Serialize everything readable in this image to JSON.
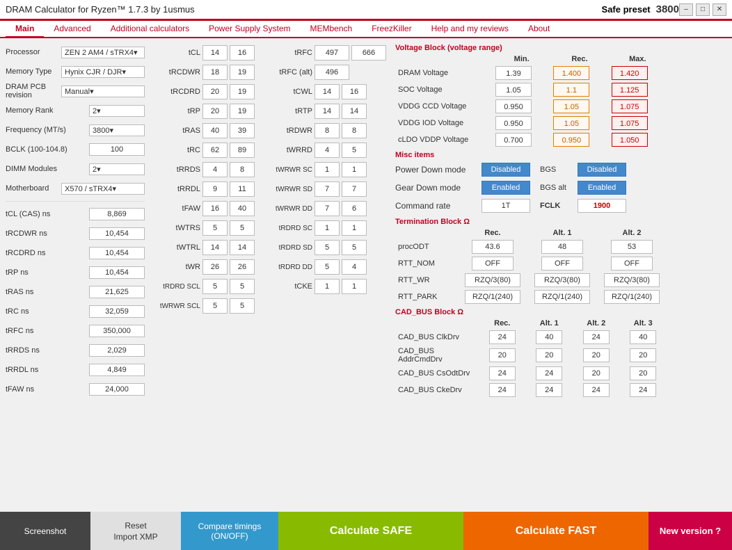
{
  "titlebar": {
    "title": "DRAM Calculator for Ryzen™ 1.7.3 by 1usmus",
    "preset_label": "Safe preset",
    "preset_freq": "3800",
    "controls": {
      "minimize": "–",
      "maximize": "□",
      "close": "✕"
    }
  },
  "nav": {
    "tabs": [
      {
        "id": "main",
        "label": "Main",
        "active": true
      },
      {
        "id": "advanced",
        "label": "Advanced"
      },
      {
        "id": "additional",
        "label": "Additional calculators"
      },
      {
        "id": "power",
        "label": "Power Supply System"
      },
      {
        "id": "membench",
        "label": "MEMbench"
      },
      {
        "id": "freezkiller",
        "label": "FreezKiller"
      },
      {
        "id": "help",
        "label": "Help and my reviews"
      },
      {
        "id": "about",
        "label": "About"
      }
    ]
  },
  "left_panel": {
    "processor_label": "Processor",
    "processor_value": "ZEN 2 AM4 / sTRX4▾",
    "memory_type_label": "Memory Type",
    "memory_type_value": "Hynix CJR / DJR▾",
    "pcb_label": "DRAM PCB revision",
    "pcb_value": "Manual▾",
    "rank_label": "Memory Rank",
    "rank_value": "2▾",
    "freq_label": "Frequency (MT/s)",
    "freq_value": "3800▾",
    "bclk_label": "BCLK (100-104.8)",
    "bclk_value": "100",
    "dimm_label": "DIMM Modules",
    "dimm_value": "2▾",
    "motherboard_label": "Motherboard",
    "motherboard_value": "X570 / sTRX4▾",
    "tcl_ns_label": "tCL (CAS) ns",
    "tcl_ns_value": "8,869",
    "trcdwr_ns_label": "tRCDWR ns",
    "trcdwr_ns_value": "10,454",
    "trcdrd_ns_label": "tRCDRD ns",
    "trcdrd_ns_value": "10,454",
    "trp_ns_label": "tRP ns",
    "trp_ns_value": "10,454",
    "tras_ns_label": "tRAS ns",
    "tras_ns_value": "21,625",
    "trc_ns_label": "tRC ns",
    "trc_ns_value": "32,059",
    "trfc_ns_label": "tRFC ns",
    "trfc_ns_value": "350,000",
    "trrds_ns_label": "tRRDS ns",
    "trrds_ns_value": "2,029",
    "trrdl_ns_label": "tRRDL ns",
    "trrdl_ns_value": "4,849",
    "tfaw_ns_label": "tFAW ns",
    "tfaw_ns_value": "24,000"
  },
  "timings_left": [
    {
      "label": "tCL",
      "val1": "14",
      "val2": "16"
    },
    {
      "label": "tRCDWR",
      "val1": "18",
      "val2": "19"
    },
    {
      "label": "tRCDRD",
      "val1": "20",
      "val2": "19"
    },
    {
      "label": "tRP",
      "val1": "20",
      "val2": "19"
    },
    {
      "label": "tRAS",
      "val1": "40",
      "val2": "39"
    },
    {
      "label": "tRC",
      "val1": "62",
      "val2": "89"
    },
    {
      "label": "tRRDS",
      "val1": "4",
      "val2": "8"
    },
    {
      "label": "tRRDL",
      "val1": "9",
      "val2": "11"
    },
    {
      "label": "tFAW",
      "val1": "16",
      "val2": "40"
    },
    {
      "label": "tWTRS",
      "val1": "5",
      "val2": "5"
    },
    {
      "label": "tWTRL",
      "val1": "14",
      "val2": "14"
    },
    {
      "label": "tWR",
      "val1": "26",
      "val2": "26"
    },
    {
      "label": "tRDRD SCL",
      "val1": "5",
      "val2": "5"
    },
    {
      "label": "tWRWR SCL",
      "val1": "5",
      "val2": "5"
    }
  ],
  "timings_right": [
    {
      "label": "tRFC",
      "val1": "497",
      "val2": "666"
    },
    {
      "label": "tRFC (alt)",
      "val1": "496",
      "val2": ""
    },
    {
      "label": "tCWL",
      "val1": "14",
      "val2": "16"
    },
    {
      "label": "tRTP",
      "val1": "14",
      "val2": "14"
    },
    {
      "label": "tRDWR",
      "val1": "8",
      "val2": "8"
    },
    {
      "label": "tWRRD",
      "val1": "4",
      "val2": "5"
    },
    {
      "label": "tWRWR SC",
      "val1": "1",
      "val2": "1"
    },
    {
      "label": "tWRWR SD",
      "val1": "7",
      "val2": "7"
    },
    {
      "label": "tWRWR DD",
      "val1": "7",
      "val2": "6"
    },
    {
      "label": "tRDRD SC",
      "val1": "1",
      "val2": "1"
    },
    {
      "label": "tRDRD SD",
      "val1": "5",
      "val2": "5"
    },
    {
      "label": "tRDRD DD",
      "val1": "5",
      "val2": "4"
    },
    {
      "label": "tCKE",
      "val1": "1",
      "val2": "1"
    }
  ],
  "voltage_block": {
    "header": "Voltage Block (voltage range)",
    "col_min": "Min.",
    "col_rec": "Rec.",
    "col_max": "Max.",
    "rows": [
      {
        "label": "DRAM Voltage",
        "min": "1.39",
        "rec": "1.400",
        "max": "1.420"
      },
      {
        "label": "SOC Voltage",
        "min": "1.05",
        "rec": "1.1",
        "max": "1.125"
      },
      {
        "label": "VDDG  CCD Voltage",
        "min": "0.950",
        "rec": "1.05",
        "max": "1.075"
      },
      {
        "label": "VDDG  IOD Voltage",
        "min": "0.950",
        "rec": "1.05",
        "max": "1.075"
      },
      {
        "label": "cLDO VDDP Voltage",
        "min": "0.700",
        "rec": "0.950",
        "max": "1.050"
      }
    ]
  },
  "misc_block": {
    "header": "Misc items",
    "rows": [
      {
        "label": "Power Down mode",
        "val1": "Disabled",
        "label2": "BGS",
        "val2": "Disabled"
      },
      {
        "label": "Gear Down mode",
        "val1": "Enabled",
        "label2": "BGS alt",
        "val2": "Enabled"
      },
      {
        "label": "Command rate",
        "val1": "1T",
        "label2": "FCLK",
        "val2": "1900"
      }
    ]
  },
  "termination_block": {
    "header": "Termination Block Ω",
    "col_rec": "Rec.",
    "col_alt1": "Alt. 1",
    "col_alt2": "Alt. 2",
    "rows": [
      {
        "label": "procODT",
        "rec": "43.6",
        "alt1": "48",
        "alt2": "53"
      },
      {
        "label": "RTT_NOM",
        "rec": "OFF",
        "alt1": "OFF",
        "alt2": "OFF"
      },
      {
        "label": "RTT_WR",
        "rec": "RZQ/3(80)",
        "alt1": "RZQ/3(80)",
        "alt2": "RZQ/3(80)"
      },
      {
        "label": "RTT_PARK",
        "rec": "RZQ/1(240)",
        "alt1": "RZQ/1(240)",
        "alt2": "RZQ/1(240)"
      }
    ]
  },
  "cad_block": {
    "header": "CAD_BUS Block Ω",
    "col_rec": "Rec.",
    "col_alt1": "Alt. 1",
    "col_alt2": "Alt. 2",
    "col_alt3": "Alt. 3",
    "rows": [
      {
        "label": "CAD_BUS ClkDrv",
        "rec": "24",
        "alt1": "40",
        "alt2": "24",
        "alt3": "40"
      },
      {
        "label": "CAD_BUS AddrCmdDrv",
        "rec": "20",
        "alt1": "20",
        "alt2": "20",
        "alt3": "20"
      },
      {
        "label": "CAD_BUS CsOdtDrv",
        "rec": "24",
        "alt1": "24",
        "alt2": "20",
        "alt3": "20"
      },
      {
        "label": "CAD_BUS CkeDrv",
        "rec": "24",
        "alt1": "24",
        "alt2": "24",
        "alt3": "24"
      }
    ]
  },
  "bottom_bar": {
    "screenshot_label": "Screenshot",
    "reset_label": "Reset",
    "import_xmp_label": "Import XMP",
    "compare_line1": "Compare timings",
    "compare_line2": "(ON/OFF)",
    "calculate_safe": "Calculate SAFE",
    "calculate_fast": "Calculate FAST",
    "new_version": "New version ?"
  }
}
